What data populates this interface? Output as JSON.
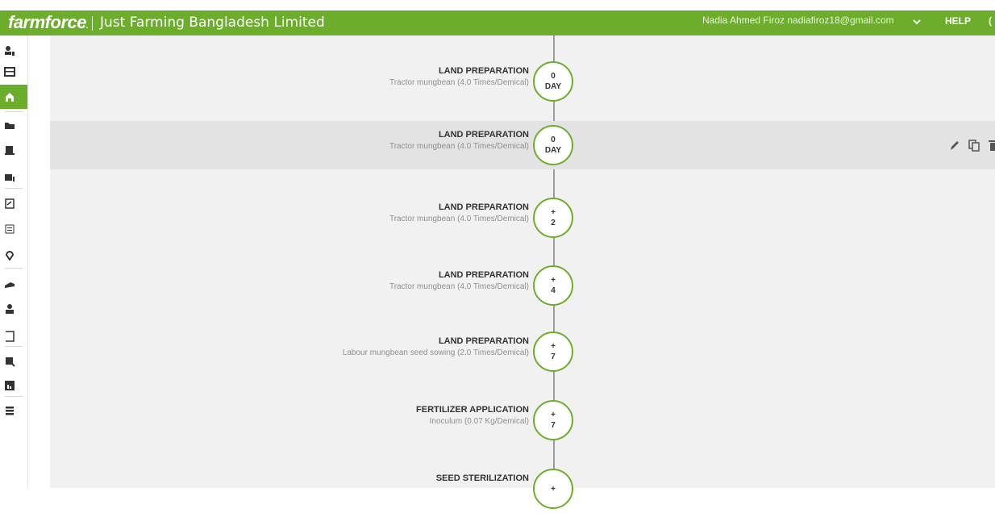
{
  "header": {
    "brand": "farmforce",
    "brand_dot": ".",
    "company": "Just Farming Bangladesh Limited",
    "user": "Nadia Ahmed Firoz nadiafiroz18@gmail.com",
    "help": "HELP",
    "more": "(",
    "accent": "#6cad2c"
  },
  "sidebar": {
    "items": [
      {
        "icon": "person-list-icon"
      },
      {
        "icon": "table-icon"
      },
      {
        "icon": "home-icon",
        "active": true
      },
      {
        "icon": "folder-icon"
      },
      {
        "icon": "document-add-icon"
      },
      {
        "icon": "people-icon"
      },
      {
        "icon": "clipboard-icon"
      },
      {
        "icon": "list-icon"
      },
      {
        "icon": "location-pin-icon"
      },
      {
        "icon": "payment-icon"
      },
      {
        "icon": "user-icon"
      },
      {
        "icon": "bracket-icon"
      },
      {
        "icon": "search-person-icon"
      },
      {
        "icon": "report-icon"
      },
      {
        "icon": "menu-icon"
      }
    ]
  },
  "timeline": {
    "events": [
      {
        "title": "LAND PREPARATION",
        "detail": "Tractor mungbean (4.0 Times/Demical)",
        "line1": "0",
        "line2": "DAY"
      },
      {
        "title": "LAND PREPARATION",
        "detail": "Tractor mungbean (4.0 Times/Demical)",
        "line1": "0",
        "line2": "DAY",
        "selected": true
      },
      {
        "title": "LAND PREPARATION",
        "detail": "Tractor mungbean (4.0 Times/Demical)",
        "line1": "+",
        "line2": "2"
      },
      {
        "title": "LAND PREPARATION",
        "detail": "Tractor mungbean (4.0 Times/Demical)",
        "line1": "+",
        "line2": "4"
      },
      {
        "title": "LAND PREPARATION",
        "detail": "Labour mungbean seed sowing (2.0 Times/Demical)",
        "line1": "+",
        "line2": "7"
      },
      {
        "title": "FERTILIZER APPLICATION",
        "detail": "Inoculum (0.07 Kg/Demical)",
        "line1": "+",
        "line2": "7"
      },
      {
        "title": "SEED STERILIZATION",
        "detail": "",
        "line1": "+",
        "line2": ""
      }
    ],
    "row_actions": [
      "edit-icon",
      "copy-icon",
      "delete-icon"
    ]
  }
}
